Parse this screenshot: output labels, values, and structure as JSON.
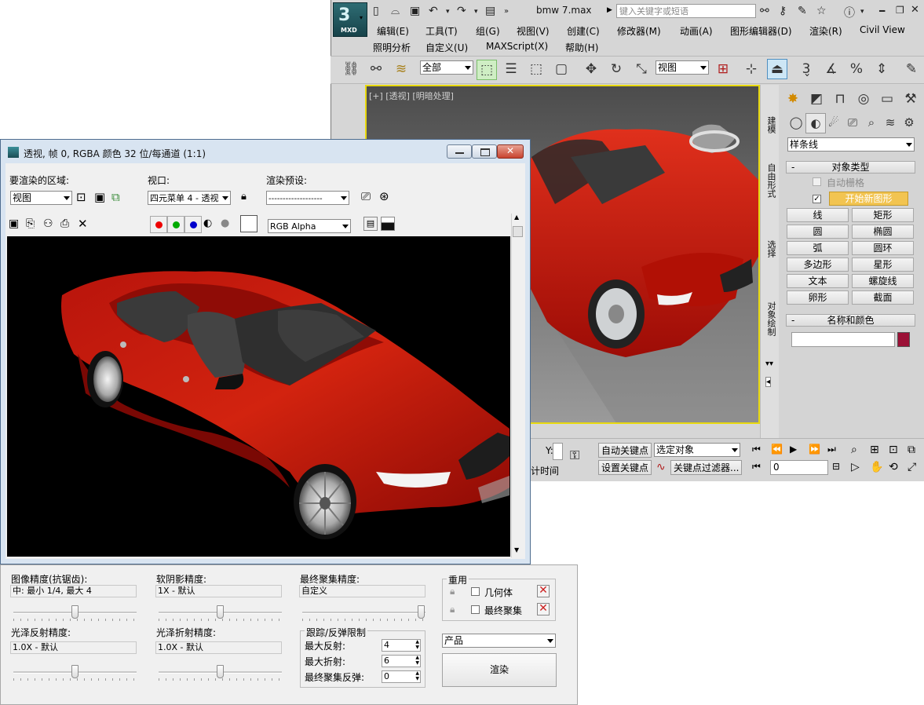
{
  "max": {
    "logo_text": "MXD",
    "doc_title": "bmw 7.max",
    "search_placeholder": "键入关键字或短语",
    "menu_row1": [
      "编辑(E)",
      "工具(T)",
      "组(G)",
      "视图(V)",
      "创建(C)",
      "修改器(M)",
      "动画(A)",
      "图形编辑器(D)",
      "渲染(R)",
      "Civil View"
    ],
    "menu_row2": [
      "照明分析",
      "自定义(U)",
      "MAXScript(X)",
      "帮助(H)"
    ],
    "selection_filter": "全部",
    "ref_coord": "视图",
    "viewport_label": "[+] [透视] [明暗处理]",
    "side_tabs": [
      "建模",
      "自由形式",
      "选择",
      "对象绘制"
    ],
    "cmd": {
      "dropdown": "样条线",
      "rollout_object_type": "对象类型",
      "autogrid": "自动栅格",
      "start_new_shape": "开始新图形",
      "buttons": [
        "线",
        "矩形",
        "圆",
        "椭圆",
        "弧",
        "圆环",
        "多边形",
        "星形",
        "文本",
        "螺旋线",
        "卵形",
        "截面"
      ],
      "rollout_name_color": "名称和颜色",
      "object_color": "#9b1136"
    },
    "anim": {
      "y_label": "Y:",
      "auto_key": "自动关键点",
      "set_key": "设置关键点",
      "selected_obj": "选定对象",
      "key_filters": "关键点过滤器...",
      "frame_value": "0",
      "partial_label": "计时间"
    }
  },
  "render_frame": {
    "title": "透视, 帧 0, RGBA 颜色 32 位/每通道 (1:1)",
    "area_label": "要渲染的区域:",
    "area_value": "视图",
    "viewport_label": "视口:",
    "viewport_value": "四元菜单 4 - 透视",
    "preset_label": "渲染预设:",
    "preset_value": "-------------------",
    "channel": "RGB Alpha"
  },
  "settings": {
    "image_precision_label": "图像精度(抗锯齿):",
    "image_precision_value": "中: 最小 1/4, 最大 4",
    "soft_shadow_label": "软阴影精度:",
    "soft_shadow_value": "1X - 默认",
    "final_gather_label": "最终聚集精度:",
    "final_gather_value": "自定义",
    "glossy_reflect_label": "光泽反射精度:",
    "glossy_reflect_value": "1.0X - 默认",
    "glossy_refract_label": "光泽折射精度:",
    "glossy_refract_value": "1.0X - 默认",
    "trace_group": "跟踪/反弹限制",
    "max_reflect_label": "最大反射:",
    "max_reflect": "4",
    "max_refract_label": "最大折射:",
    "max_refract": "6",
    "fg_bounce_label": "最终聚集反弹:",
    "fg_bounce": "0",
    "reuse_group": "重用",
    "geometry": "几何体",
    "final_gather": "最终聚集",
    "product": "产品",
    "render_button": "渲染"
  }
}
